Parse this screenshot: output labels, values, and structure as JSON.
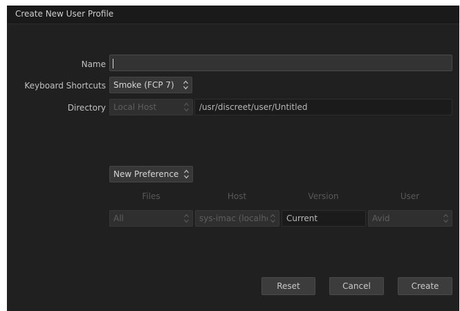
{
  "window": {
    "title": "Create New User Profile"
  },
  "form": {
    "name_label": "Name",
    "name_value": "",
    "keyboard_label": "Keyboard Shortcuts",
    "keyboard_value": "Smoke (FCP 7)",
    "directory_label": "Directory",
    "directory_location": "Local Host",
    "directory_path": "/usr/discreet/user/Untitled"
  },
  "preferences": {
    "source_value": "New Preferences",
    "columns": [
      "Files",
      "Host",
      "Version",
      "User"
    ],
    "files_value": "All",
    "host_value": "sys-imac (localhost)",
    "version_value": "Current",
    "user_value": "Avid"
  },
  "buttons": {
    "reset": "Reset",
    "cancel": "Cancel",
    "create": "Create"
  },
  "icons": {
    "stepper": "up-down-chevron-icon",
    "text_caret": "text-cursor-icon"
  },
  "colors": {
    "dialog_background": "#202020",
    "titlebar_background": "#1a1a1a",
    "field_background": "#333333",
    "button_background": "#3c3c3c"
  }
}
